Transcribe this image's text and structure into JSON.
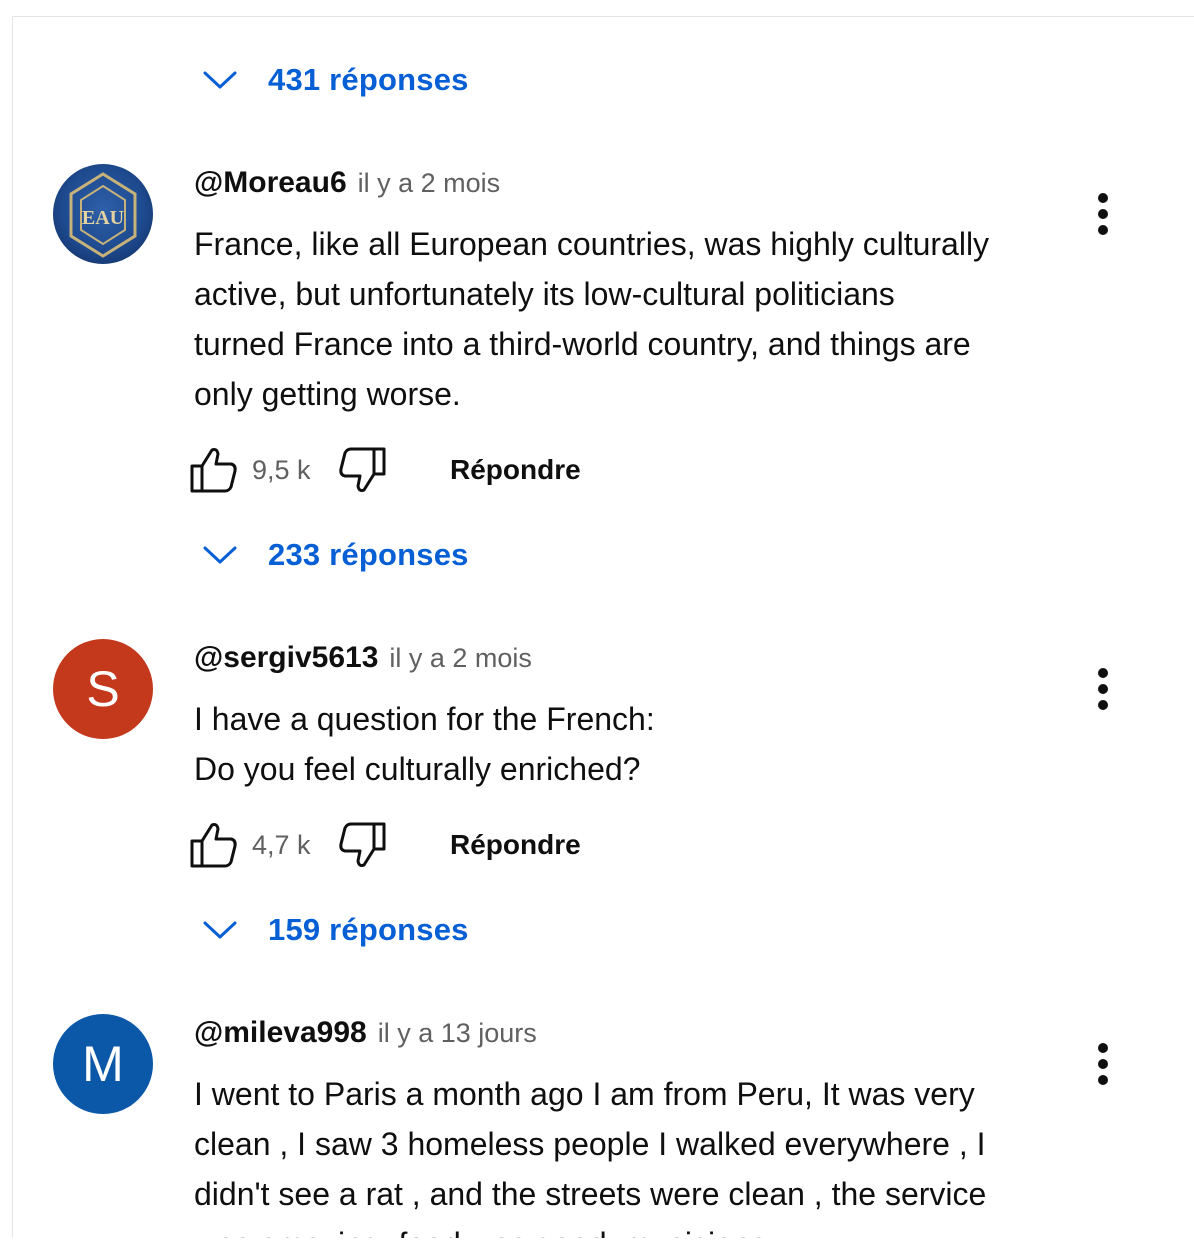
{
  "replies_top": {
    "label": "431 réponses"
  },
  "comments": [
    {
      "author": "@Moreau6",
      "time": "il y a 2 mois",
      "text": "France, like all European countries, was highly culturally\nactive, but unfortunately its low-cultural politicians\nturned France into a third-world country, and things are\nonly getting worse.",
      "likes": "9,5 k",
      "reply_label": "Répondre",
      "replies_label": "233 réponses",
      "avatar": {
        "type": "logo",
        "colors": [
          "#2e5fa8",
          "#0d2a57",
          "#c7b37a"
        ]
      }
    },
    {
      "author": "@sergiv5613",
      "time": "il y a 2 mois",
      "text": "I have a question for the French:\nDo you feel culturally enriched?",
      "likes": "4,7 k",
      "reply_label": "Répondre",
      "replies_label": "159 réponses",
      "avatar": {
        "type": "letter",
        "letter": "S",
        "color": "#c4381c"
      }
    },
    {
      "author": "@mileva998",
      "time": "il y a 13 jours",
      "text": "I went to Paris a month ago I am from Peru,  It was very\nclean , I saw 3 homeless people I walked everywhere , I\ndidn't see a rat , and the streets were clean , the service\nwas amazing, food was good, musicians",
      "avatar": {
        "type": "letter",
        "letter": "M",
        "color": "#0b57a8"
      }
    }
  ],
  "colors": {
    "link_blue": "#065fd4",
    "text_primary": "#0f0f0f",
    "text_secondary": "#606060"
  }
}
